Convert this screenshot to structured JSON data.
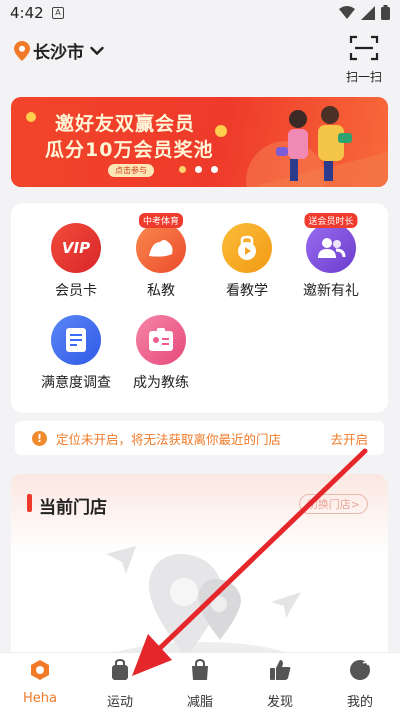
{
  "status_bar": {
    "time": "4:42",
    "app_icon": "A"
  },
  "header": {
    "city": "长沙市",
    "scan_label": "扫一扫"
  },
  "banner": {
    "line1": "邀好友双赢会员",
    "line2": "瓜分10万会员奖池",
    "cta": "点击参与",
    "active_dot": 0
  },
  "services": [
    {
      "label": "会员卡",
      "tag": "",
      "color": "#e8362e",
      "icon": "vip-icon"
    },
    {
      "label": "私教",
      "tag": "中考体育",
      "color": "#f26a3a",
      "icon": "muscle-icon"
    },
    {
      "label": "看教学",
      "tag": "",
      "color": "#f5a623",
      "icon": "kettlebell-icon"
    },
    {
      "label": "邀新有礼",
      "tag": "送会员时长",
      "color": "#7a4fd8",
      "icon": "people-icon"
    },
    {
      "label": "满意度调查",
      "tag": "",
      "color": "#3b6cf5",
      "icon": "survey-icon"
    },
    {
      "label": "成为教练",
      "tag": "",
      "color": "#ee5b8a",
      "icon": "badge-icon"
    }
  ],
  "notice": {
    "message": "定位未开启，将无法获取离你最近的门店",
    "action": "去开启"
  },
  "store": {
    "title": "当前门店",
    "switch_label": "切换门店>"
  },
  "tabs": [
    {
      "label": "Heha",
      "icon": "heha-icon",
      "active": true
    },
    {
      "label": "运动",
      "icon": "bag-icon",
      "active": false
    },
    {
      "label": "减脂",
      "icon": "shopping-bag-icon",
      "active": false
    },
    {
      "label": "发现",
      "icon": "thumb-up-icon",
      "active": false
    },
    {
      "label": "我的",
      "icon": "profile-icon",
      "active": false
    }
  ],
  "colors": {
    "accent": "#f07a28",
    "brand_red": "#ee3a2a",
    "annotation_arrow": "#e5262a"
  }
}
